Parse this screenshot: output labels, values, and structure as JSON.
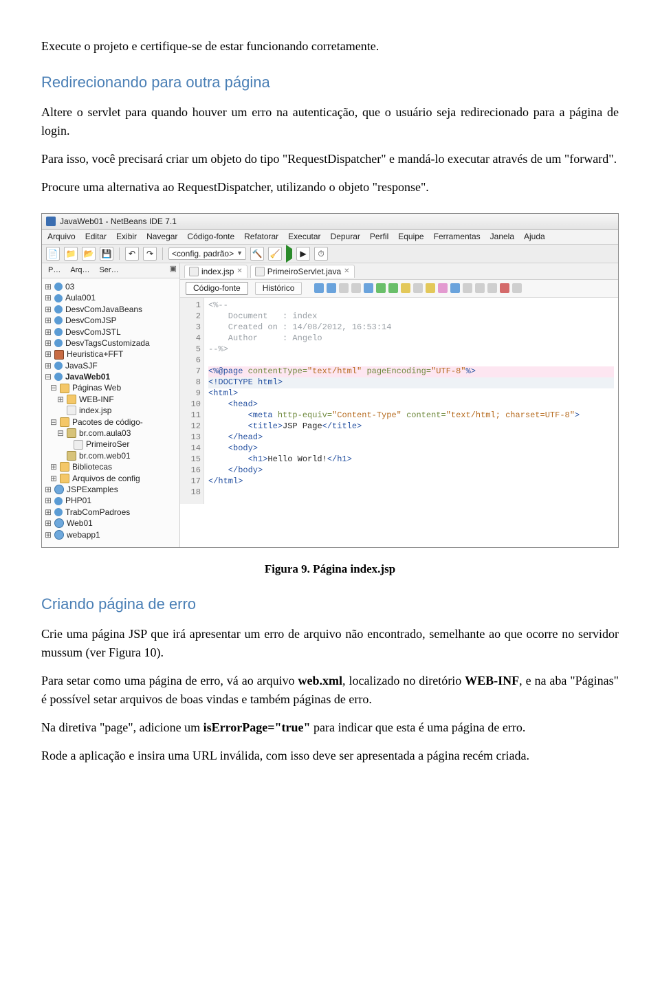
{
  "doc": {
    "p1": "Execute o projeto e certifique-se de estar funcionando corretamente.",
    "h1": "Redirecionando para outra página",
    "p2": "Altere o servlet para quando houver um erro na autenticação, que o usuário seja redirecionado para a página de login.",
    "p3": "Para isso, você precisará criar um objeto do tipo \"RequestDispatcher\" e mandá-lo executar através de um \"forward\".",
    "p4": "Procure uma alternativa ao RequestDispatcher, utilizando o objeto \"response\".",
    "fig_caption": "Figura 9. Página index.jsp",
    "h2": "Criando página de erro",
    "p5a": "Crie uma página JSP que irá apresentar um erro de arquivo não encontrado, semelhante ao que ocorre no servidor mussum (ver Figura 10).",
    "p6a": "Para setar como uma página de erro, vá ao arquivo ",
    "p6b": "web.xml",
    "p6c": ", localizado no diretório ",
    "p6d": "WEB-INF",
    "p6e": ", e na aba \"Páginas\" é possível setar arquivos de boas vindas e também páginas de erro.",
    "p7a": "Na diretiva \"page\", adicione um ",
    "p7b": "isErrorPage=\"true\"",
    "p7c": " para indicar que esta é uma página de erro.",
    "p8": "Rode a aplicação e insira uma URL inválida, com isso deve ser apresentada a página recém criada."
  },
  "ide": {
    "title": "JavaWeb01 - NetBeans IDE 7.1",
    "menu": [
      "Arquivo",
      "Editar",
      "Exibir",
      "Navegar",
      "Código-fonte",
      "Refatorar",
      "Executar",
      "Depurar",
      "Perfil",
      "Equipe",
      "Ferramentas",
      "Janela",
      "Ajuda"
    ],
    "config": "<config. padrão>",
    "lefttabs": {
      "p": "P…",
      "arq": "Arq…",
      "ser": "Ser…"
    },
    "tree": [
      {
        "lvl": 0,
        "tw": "⊞",
        "ic": "proj",
        "label": "03"
      },
      {
        "lvl": 0,
        "tw": "⊞",
        "ic": "proj",
        "label": "Aula001"
      },
      {
        "lvl": 0,
        "tw": "⊞",
        "ic": "proj",
        "label": "DesvComJavaBeans"
      },
      {
        "lvl": 0,
        "tw": "⊞",
        "ic": "proj",
        "label": "DesvComJSP"
      },
      {
        "lvl": 0,
        "tw": "⊞",
        "ic": "proj",
        "label": "DesvComJSTL"
      },
      {
        "lvl": 0,
        "tw": "⊞",
        "ic": "proj",
        "label": "DesvTagsCustomizada"
      },
      {
        "lvl": 0,
        "tw": "⊞",
        "ic": "coffee",
        "label": "Heuristica+FFT"
      },
      {
        "lvl": 0,
        "tw": "⊞",
        "ic": "proj",
        "label": "JavaSJF"
      },
      {
        "lvl": 0,
        "tw": "⊟",
        "ic": "proj",
        "label": "JavaWeb01",
        "bold": true
      },
      {
        "lvl": 1,
        "tw": "⊟",
        "ic": "folder",
        "label": "Páginas Web"
      },
      {
        "lvl": 2,
        "tw": "⊞",
        "ic": "folder",
        "label": "WEB-INF"
      },
      {
        "lvl": 2,
        "tw": "",
        "ic": "file",
        "label": "index.jsp"
      },
      {
        "lvl": 1,
        "tw": "⊟",
        "ic": "folder",
        "label": "Pacotes de código-"
      },
      {
        "lvl": 2,
        "tw": "⊟",
        "ic": "pkg",
        "label": "br.com.aula03"
      },
      {
        "lvl": 3,
        "tw": "",
        "ic": "file",
        "label": "PrimeiroSer"
      },
      {
        "lvl": 2,
        "tw": "",
        "ic": "pkg",
        "label": "br.com.web01"
      },
      {
        "lvl": 1,
        "tw": "⊞",
        "ic": "folder",
        "label": "Bibliotecas"
      },
      {
        "lvl": 1,
        "tw": "⊞",
        "ic": "folder",
        "label": "Arquivos de config"
      },
      {
        "lvl": 0,
        "tw": "⊞",
        "ic": "globe",
        "label": "JSPExamples"
      },
      {
        "lvl": 0,
        "tw": "⊞",
        "ic": "proj",
        "label": "PHP01"
      },
      {
        "lvl": 0,
        "tw": "⊞",
        "ic": "proj",
        "label": "TrabComPadroes"
      },
      {
        "lvl": 0,
        "tw": "⊞",
        "ic": "globe",
        "label": "Web01"
      },
      {
        "lvl": 0,
        "tw": "⊞",
        "ic": "globe",
        "label": "webapp1"
      }
    ],
    "editortabs": [
      {
        "icon": "file",
        "label": "index.jsp"
      },
      {
        "icon": "file",
        "label": "PrimeiroServlet.java"
      }
    ],
    "subtabs": {
      "source": "Código-fonte",
      "history": "Histórico"
    },
    "code": {
      "comment_open": "<%--",
      "comment_doc": "    Document   : index",
      "comment_date": "    Created on : 14/08/2012, 16:53:14",
      "comment_auth": "    Author     : Angelo",
      "comment_close": "--%>",
      "blank": "",
      "l7a": "<%@page ",
      "l7b": "contentType=",
      "l7c": "\"text/html\"",
      "l7d": " pageEncoding=",
      "l7e": "\"UTF-8\"",
      "l7f": "%>",
      "l8": "<!DOCTYPE html>",
      "l9": "<html>",
      "l10": "    <head>",
      "l11a": "        <meta ",
      "l11b": "http-equiv=",
      "l11c": "\"Content-Type\"",
      "l11d": " content=",
      "l11e": "\"text/html; charset=UTF-8\"",
      "l11f": ">",
      "l12a": "        <title>",
      "l12b": "JSP Page",
      "l12c": "</title>",
      "l13": "    </head>",
      "l14": "    <body>",
      "l15a": "        <h1>",
      "l15b": "Hello World!",
      "l15c": "</h1>",
      "l16": "    </body>",
      "l17": "</html>"
    }
  }
}
